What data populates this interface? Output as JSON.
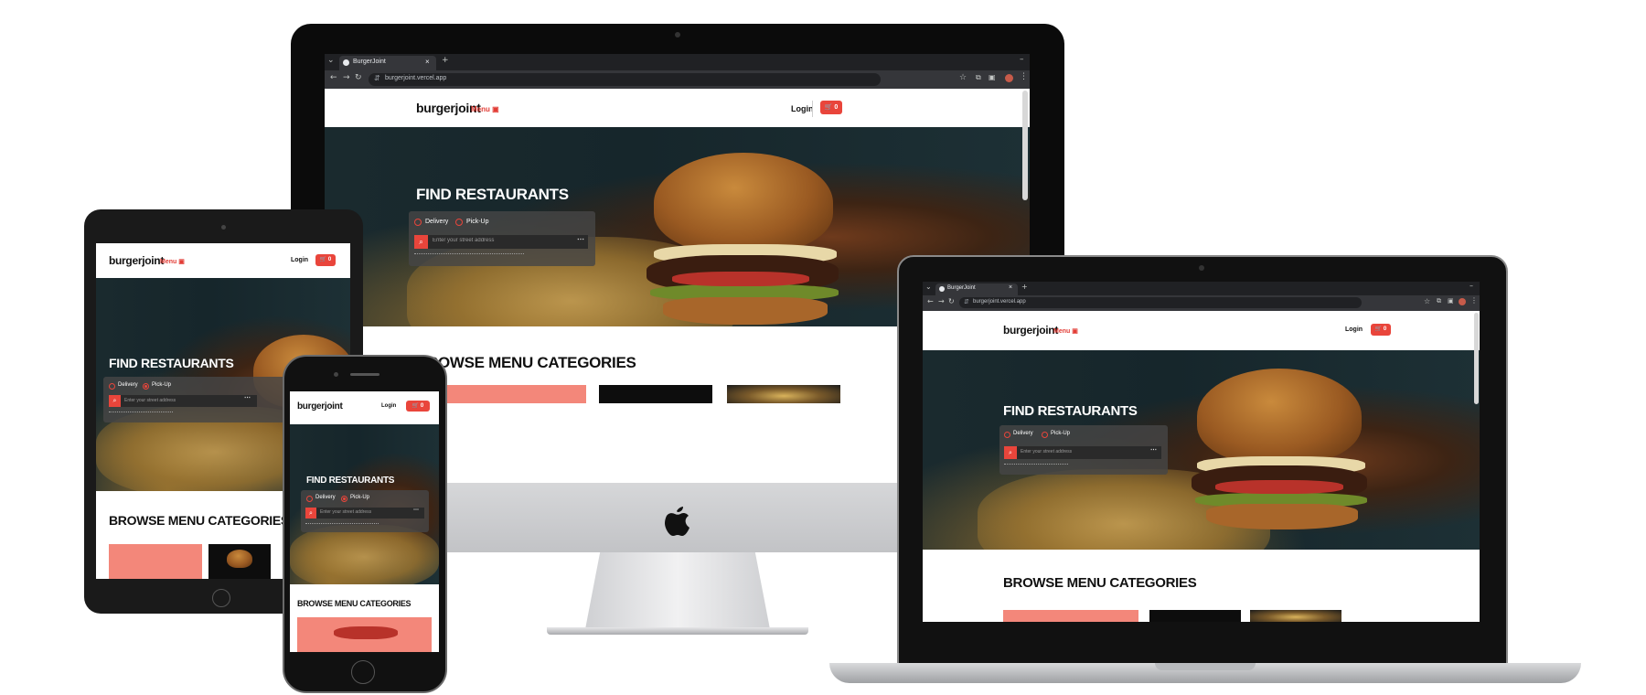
{
  "site": {
    "logo": "burgerjoint",
    "menu_label": "Menu",
    "menu_icon": "menu-book-icon",
    "login_label": "Login",
    "cart_count": "0",
    "cart_icon": "cart-icon",
    "hero_title": "FIND RESTAURANTS",
    "delivery_label": "Delivery",
    "pickup_label": "Pick-Up",
    "search_placeholder": "Enter your street address",
    "search_icon": "search-icon",
    "browse_title": "BROWSE MENU CATEGORIES",
    "colors": {
      "accent": "#e9453b",
      "salmon": "#f3877a",
      "dark": "#0d0d0d"
    }
  },
  "browser": {
    "tab_title": "BurgerJoint",
    "laptop_tab_title": "BurgerJoint",
    "url": "burgerjoint.vercel.app",
    "new_tab": "+",
    "close_tab": "×"
  },
  "devices": [
    "desktop-monitor",
    "tablet",
    "phone",
    "laptop"
  ]
}
